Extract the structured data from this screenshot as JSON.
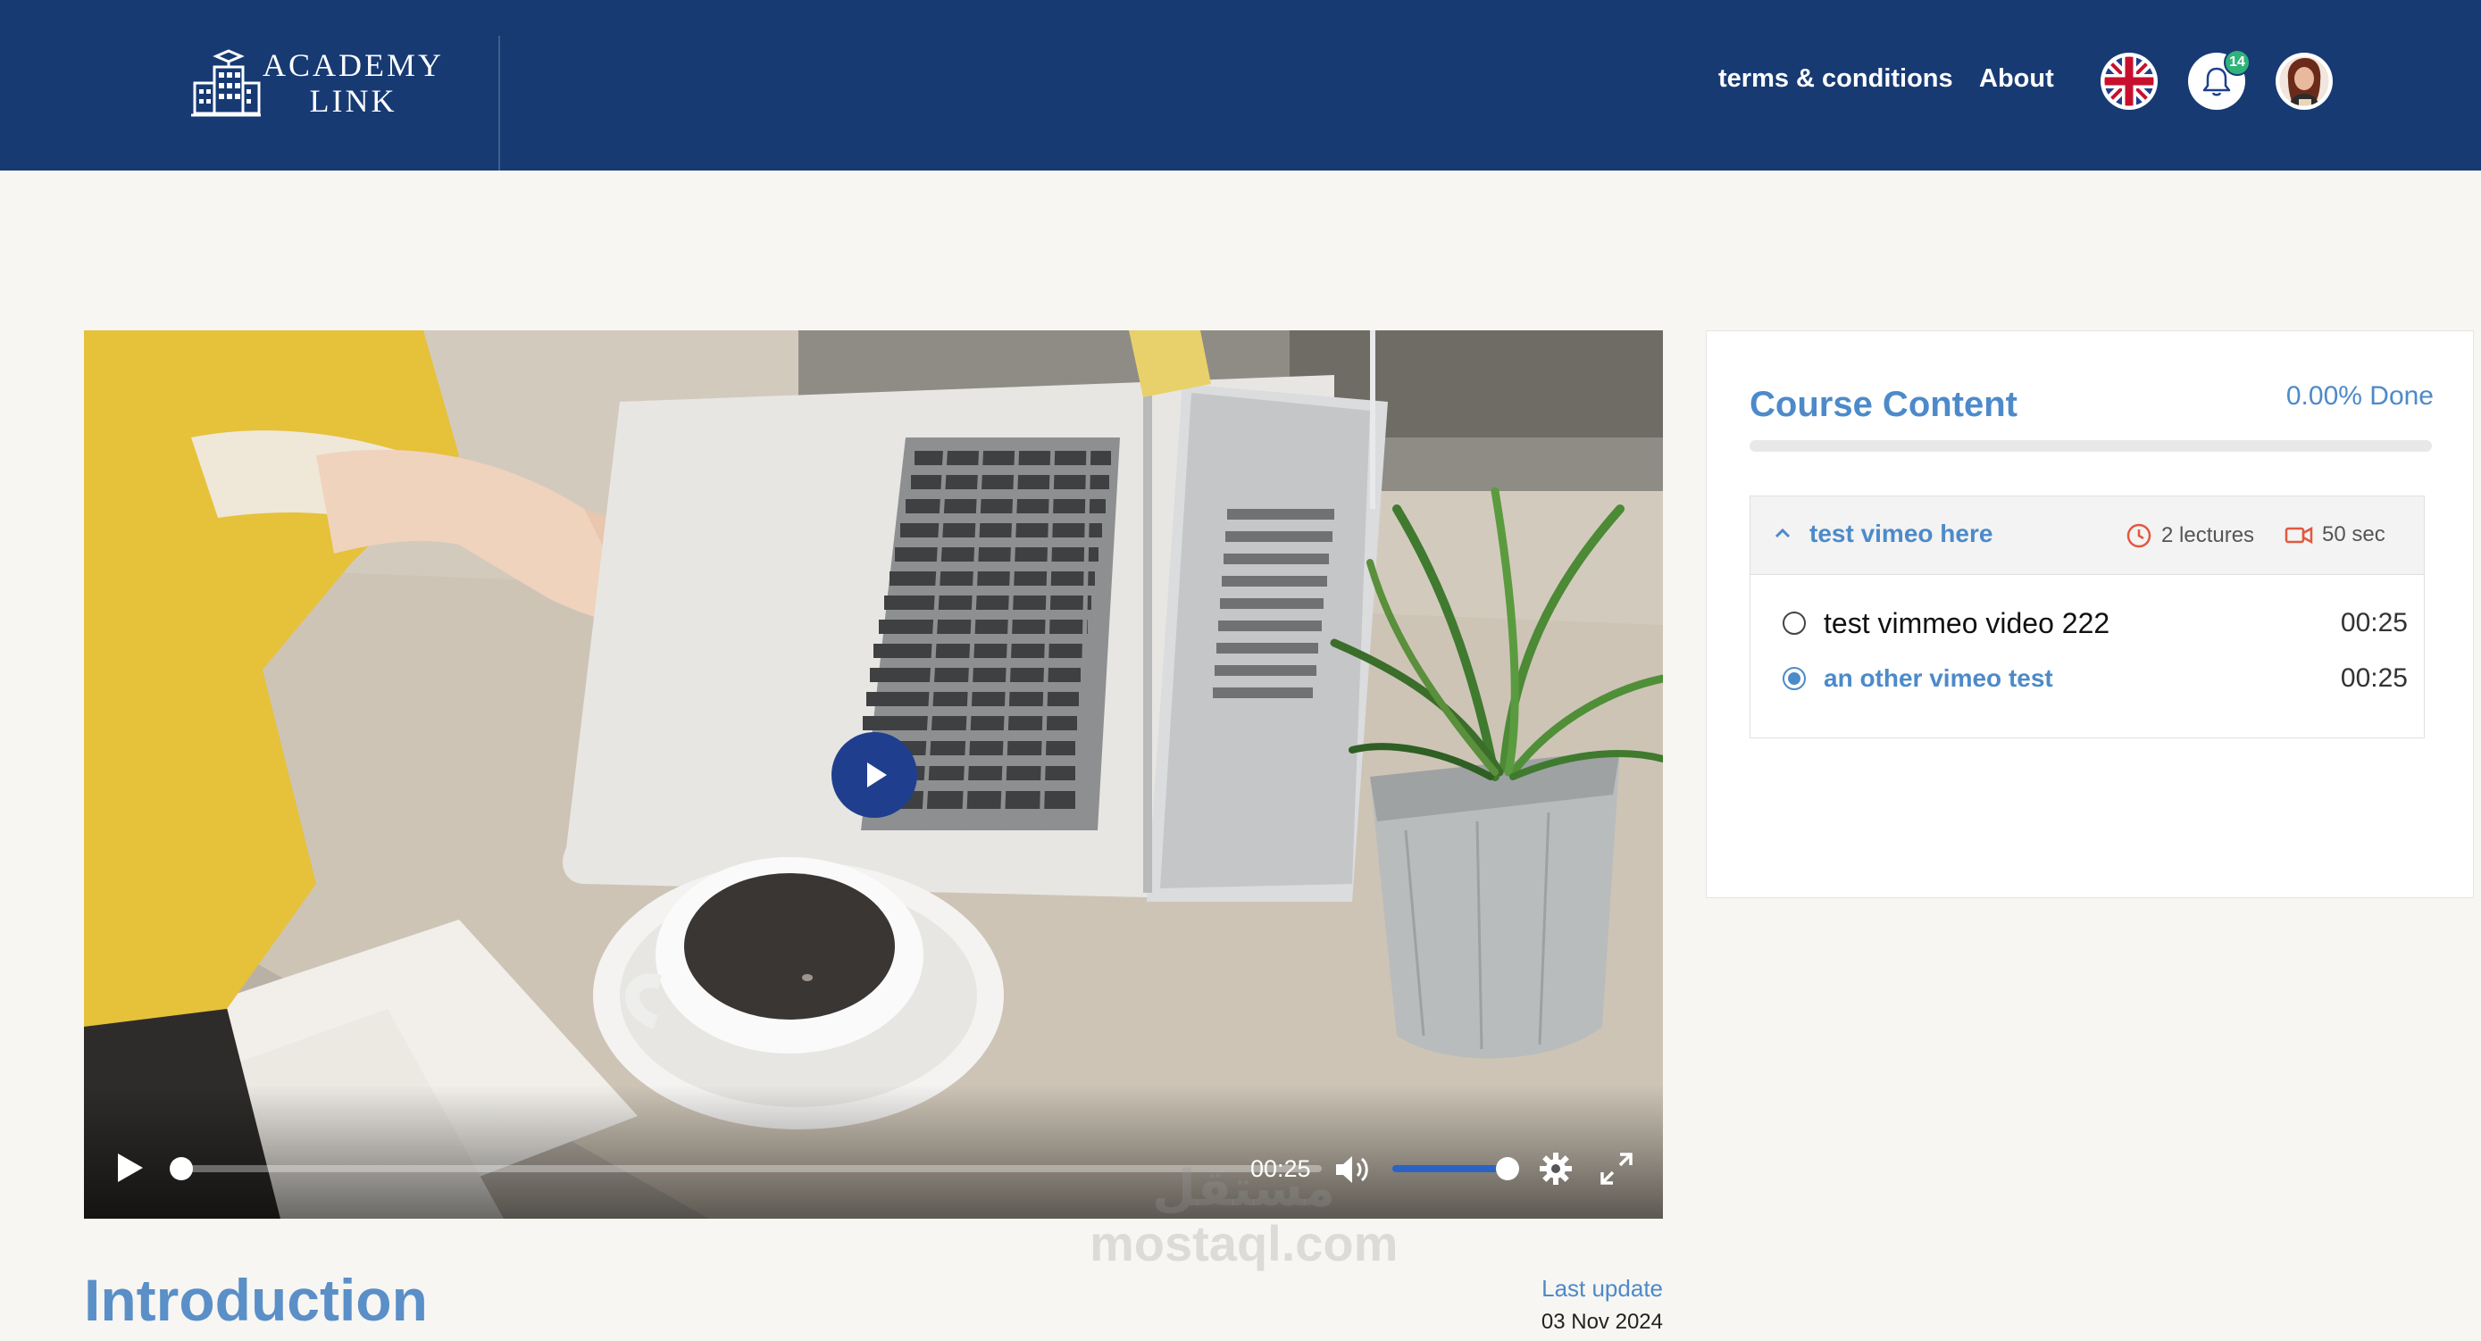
{
  "header": {
    "logo_line1": "ACADEMY",
    "logo_line2": "LINK",
    "nav": [
      {
        "label": "terms & conditions"
      },
      {
        "label": "About"
      }
    ],
    "notification_count": "14"
  },
  "player": {
    "current_time": "00:25",
    "progress": 0,
    "volume": 1
  },
  "lesson": {
    "title": "Introduction",
    "last_update_label": "Last update",
    "last_update_date": "03 Nov 2024"
  },
  "course": {
    "title": "Course Content",
    "done": "0.00% Done",
    "section": {
      "name": "test vimeo here",
      "lectures": "2 lectures",
      "duration": "50 sec"
    },
    "lectures": [
      {
        "title": "test vimmeo video 222",
        "time": "00:25",
        "active": false
      },
      {
        "title": "an other vimeo test",
        "time": "00:25",
        "active": true
      }
    ]
  },
  "watermark": {
    "line1": "مستقل",
    "line2": "mostaql.com"
  },
  "colors": {
    "header_bg": "#173a73",
    "accent": "#4d8ac9",
    "page_bg": "#f7f6f2"
  }
}
